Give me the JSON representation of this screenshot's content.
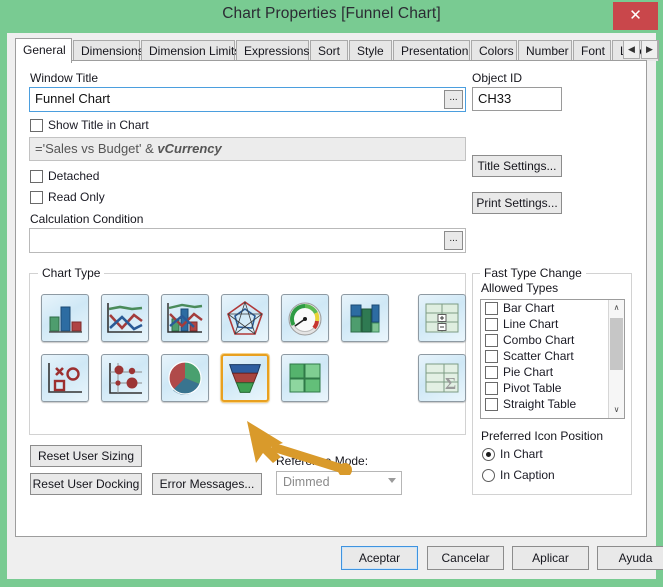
{
  "window": {
    "title": "Chart Properties [Funnel Chart]",
    "close_label": "✕",
    "accent_green": "#79cb92",
    "close_red": "#c9474b",
    "selection_orange": "#e8a020"
  },
  "tabs": {
    "items": [
      {
        "label": "General",
        "active": true
      },
      {
        "label": "Dimensions",
        "active": false
      },
      {
        "label": "Dimension Limits",
        "active": false
      },
      {
        "label": "Expressions",
        "active": false
      },
      {
        "label": "Sort",
        "active": false
      },
      {
        "label": "Style",
        "active": false
      },
      {
        "label": "Presentation",
        "active": false
      },
      {
        "label": "Colors",
        "active": false
      },
      {
        "label": "Number",
        "active": false
      },
      {
        "label": "Font",
        "active": false
      },
      {
        "label": "Layout",
        "active": false
      }
    ],
    "scroll_prev": "◀",
    "scroll_next": "▶"
  },
  "general": {
    "window_title_label": "Window Title",
    "window_title_value": "Funnel Chart",
    "show_title_in_chart_label": "Show Title in Chart",
    "show_title_in_chart_checked": false,
    "title_expression_prefix": "='Sales vs Budget' & ",
    "title_expression_variable": "vCurrency",
    "detached_label": "Detached",
    "detached_checked": false,
    "read_only_label": "Read Only",
    "read_only_checked": false,
    "calculation_condition_label": "Calculation Condition",
    "calculation_condition_value": "",
    "ellipsis_label": "...",
    "object_id_label": "Object ID",
    "object_id_value": "CH33",
    "title_settings_label": "Title Settings...",
    "print_settings_label": "Print Settings..."
  },
  "chart_type": {
    "caption": "Chart Type",
    "icons": [
      {
        "name": "bar-chart",
        "selected": false
      },
      {
        "name": "line-chart",
        "selected": false
      },
      {
        "name": "combo-chart",
        "selected": false
      },
      {
        "name": "radar-chart",
        "selected": false
      },
      {
        "name": "gauge-chart",
        "selected": false
      },
      {
        "name": "mekko-chart",
        "selected": false
      },
      {
        "name": "pivot-table",
        "selected": false
      },
      {
        "name": "scatter-chart",
        "selected": false
      },
      {
        "name": "bubble-chart",
        "selected": false
      },
      {
        "name": "pie-chart",
        "selected": false
      },
      {
        "name": "funnel-chart",
        "selected": true
      },
      {
        "name": "block-chart",
        "selected": false
      },
      {
        "name": "straight-table",
        "selected": false
      }
    ]
  },
  "bottom_left": {
    "reset_user_sizing_label": "Reset User Sizing",
    "reset_user_docking_label": "Reset User Docking",
    "error_messages_label": "Error Messages...",
    "reference_mode_label": "Reference Mode:",
    "reference_mode_value": "Dimmed"
  },
  "fast_type_change": {
    "caption": "Fast Type Change",
    "allowed_types_label": "Allowed Types",
    "types": [
      {
        "label": "Bar Chart",
        "checked": false
      },
      {
        "label": "Line Chart",
        "checked": false
      },
      {
        "label": "Combo Chart",
        "checked": false
      },
      {
        "label": "Scatter Chart",
        "checked": false
      },
      {
        "label": "Pie Chart",
        "checked": false
      },
      {
        "label": "Pivot Table",
        "checked": false
      },
      {
        "label": "Straight Table",
        "checked": false
      }
    ],
    "scroll_up": "∧",
    "scroll_down": "∨"
  },
  "icon_position": {
    "label": "Preferred Icon Position",
    "options": [
      {
        "label": "In Chart",
        "selected": true
      },
      {
        "label": "In Caption",
        "selected": false
      }
    ]
  },
  "footer": {
    "accept_label": "Aceptar",
    "cancel_label": "Cancelar",
    "apply_label": "Aplicar",
    "help_label": "Ayuda"
  },
  "annotation": {
    "name": "orange-arrow-pointing-to-funnel-icon",
    "color": "#d99a2b"
  }
}
